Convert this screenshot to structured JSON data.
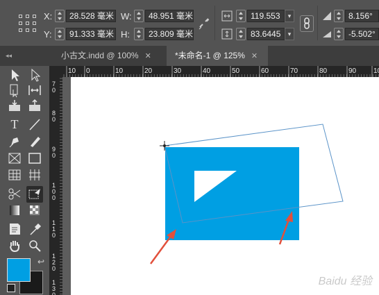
{
  "control_panel": {
    "x_label": "X:",
    "x_value": "28.528 毫米",
    "y_label": "Y:",
    "y_value": "91.333 毫米",
    "w_label": "W:",
    "w_value": "48.951 毫米",
    "h_label": "H:",
    "h_value": "23.809 毫米",
    "scale_x_value": "119.553",
    "scale_y_value": "83.6445",
    "rotate_value": "8.156°",
    "shear_value": "-5.502°"
  },
  "tabs": [
    {
      "label": "小古文.indd @ 100%",
      "close": "✕"
    },
    {
      "label": "*未命名-1  @ 125%",
      "close": "✕"
    }
  ],
  "collapse_glyph": "◂◂",
  "ruler_h_ticks": [
    "10",
    "0",
    "10",
    "20",
    "30",
    "40",
    "50",
    "60",
    "70",
    "80",
    "90",
    "100"
  ],
  "ruler_v_ticks": [
    "7 0",
    "8 0",
    "9 0",
    "1 0 0",
    "1 1 0",
    "1 2 0",
    "1 3 0"
  ],
  "swatch": {
    "fill_color": "#009fe3",
    "stroke_color": "#1a1a1a"
  },
  "canvas": {
    "rect_color": "#009fe3",
    "frame_color": "#5a93c8",
    "arrow_color": "#e2503c",
    "watermark": "Baidu 经验"
  },
  "icons": {
    "constrain": "link-icon",
    "rotate": "rotate-icon",
    "shear": "shear-icon"
  }
}
